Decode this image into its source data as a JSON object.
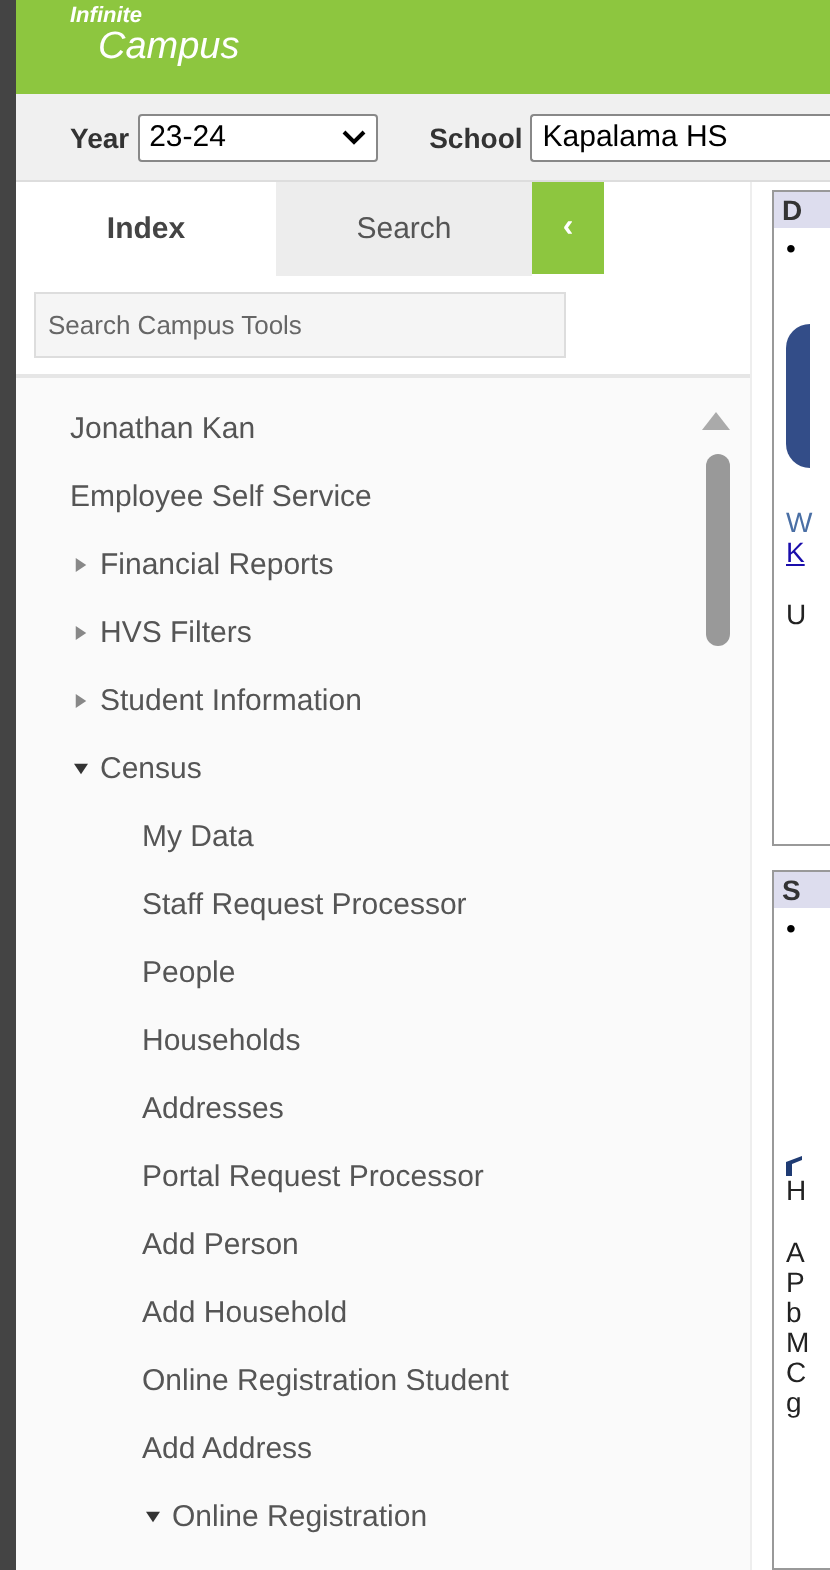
{
  "header": {
    "logo_top": "Infinite",
    "logo_bottom": "Campus"
  },
  "filters": [
    {
      "label": "Year",
      "value": "23-24",
      "kind": "dropdown"
    },
    {
      "label": "School",
      "value": "Kapalama HS",
      "kind": "text"
    }
  ],
  "tabs": [
    {
      "label": "Index",
      "selected": true
    },
    {
      "label": "Search",
      "selected": false
    }
  ],
  "collapse_button": "‹",
  "search": {
    "placeholder": "Search Campus Tools"
  },
  "tree": [
    {
      "label": "Jonathan Kan",
      "kind": "link"
    },
    {
      "label": "Employee Self Service",
      "kind": "link"
    },
    {
      "label": "Financial Reports",
      "kind": "folder",
      "expanded": false
    },
    {
      "label": "HVS Filters",
      "kind": "folder",
      "expanded": false
    },
    {
      "label": "Student Information",
      "kind": "folder",
      "expanded": false
    },
    {
      "label": "Census",
      "kind": "folder",
      "expanded": true,
      "children": [
        {
          "label": "My Data",
          "kind": "link"
        },
        {
          "label": "Staff Request Processor",
          "kind": "link"
        },
        {
          "label": "People",
          "kind": "link"
        },
        {
          "label": "Households",
          "kind": "link"
        },
        {
          "label": "Addresses",
          "kind": "link"
        },
        {
          "label": "Portal Request Processor",
          "kind": "link"
        },
        {
          "label": "Add Person",
          "kind": "link"
        },
        {
          "label": "Add Household",
          "kind": "link"
        },
        {
          "label": "Online Registration Student",
          "kind": "link"
        },
        {
          "label": "Add Address",
          "kind": "link"
        },
        {
          "label": "Online Registration",
          "kind": "folder",
          "expanded": true
        }
      ]
    }
  ],
  "panels": [
    {
      "title": "D",
      "bullet": "•",
      "lines": [
        {
          "text": "W",
          "kind": "link_blue"
        },
        {
          "text": "K",
          "kind": "link"
        },
        {
          "text": "U",
          "kind": "text"
        }
      ]
    },
    {
      "title": "S",
      "bullet": "•",
      "lines": [
        {
          "text": "H",
          "kind": "text"
        },
        {
          "text": "A",
          "kind": "text"
        },
        {
          "text": "P",
          "kind": "text"
        },
        {
          "text": "b",
          "kind": "text"
        },
        {
          "text": "M",
          "kind": "text"
        },
        {
          "text": "C",
          "kind": "text"
        },
        {
          "text": "g",
          "kind": "text"
        }
      ]
    }
  ]
}
